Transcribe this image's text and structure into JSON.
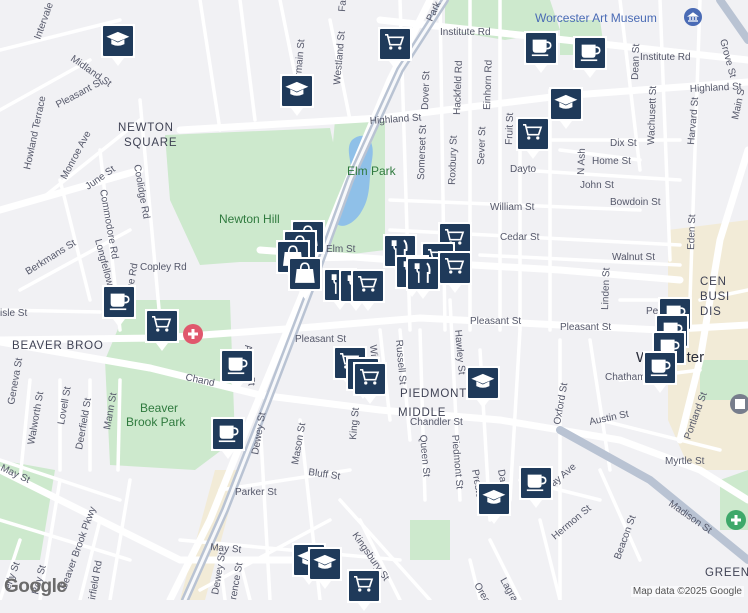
{
  "map": {
    "attribution": "Map data ©2025 Google",
    "logo": "Google",
    "colors": {
      "background": "#f1f1f4",
      "park": "#cde9cd",
      "park_dark": "#b7dcb9",
      "water": "#8fc0e8",
      "road_major": "#ffffff",
      "highway": "#b9c3d3",
      "downtown": "#f3ead0",
      "marker": "#1f3a5a",
      "poi": "#4a6bb5"
    },
    "places": {
      "newton_square_1": "NEWTON",
      "newton_square_2": "SQUARE",
      "beaver_brook": "BEAVER BROO",
      "piedmont": "PIEDMONT",
      "middle": "MIDDLE",
      "worcester": "Worcester",
      "central_1": "CEN",
      "central_2": "BUSI",
      "central_3": "DIS",
      "green": "GREEN"
    },
    "parks": {
      "elm_park": "Elm Park",
      "newton_hill": "Newton Hill",
      "beaver_brook_park_1": "Beaver",
      "beaver_brook_park_2": "Brook Park"
    },
    "poi": {
      "art_museum": "Worcester Art Museum"
    },
    "streets": {
      "institute_rd_1": "Institute Rd",
      "institute_rd_2": "Institute Rd",
      "highland_st_1": "Highland St",
      "highland_st_2": "Highland St",
      "pleasant_st_1": "Pleasant St",
      "pleasant_st_2": "Pleasant St",
      "pleasant_st_3": "Pleasant St",
      "pleasant_st_4": "Pleasant St",
      "chandler_st_1": "Chandler St",
      "chandler_st_2": "Chandler St",
      "chand": "Chand",
      "william_st": "William St",
      "cedar_st": "Cedar St",
      "walnut_st": "Walnut St",
      "elm_st": "Elm St",
      "copley_rd": "Copley Rd",
      "june_st": "June St",
      "coolidge_rd_1": "Coolidge Rd",
      "coolidge_rd_2": "Coolidge Rd",
      "commodore_rd": "Commodore Rd",
      "longfellow_rd": "Longfellow Rd",
      "berkmans_st": "Berkmans St",
      "monroe_ave": "Monroe Ave",
      "howland_terrace": "Howland Terrace",
      "midland_st": "Midland St",
      "intervale": "Intervale",
      "westland_st": "Westland St",
      "germain_st": "Germain St",
      "fa": "Fa",
      "park": "Park",
      "dover_st": "Dover St",
      "hackfeld_rd": "Hackfeld Rd",
      "einhorn_rd": "Einhorn Rd",
      "somerset_st": "Somerset St",
      "roxbury_st": "Roxbury St",
      "sever_st": "Sever St",
      "fruit_st": "Fruit St",
      "n_ash": "N Ash",
      "dix_st": "Dix St",
      "home_st": "Home St",
      "wachusett_st": "Wachusett St",
      "john_st": "John St",
      "bowdoin_st": "Bowdoin St",
      "dayto": "Dayto",
      "dean_st": "Dean St",
      "harvard_st": "Harvard St",
      "grove_st": "Grove St",
      "main_st": "Main S",
      "eden_st": "Eden St",
      "linden_st": "Linden St",
      "pearl_st": "Pearl St",
      "chatham": "Chatham",
      "austin_st": "Austin St",
      "myrtle_st": "Myrtle St",
      "portland_st": "Portland St",
      "madison_st": "Madison St",
      "oxford_st": "Oxford St",
      "beacon_st": "Beacon St",
      "hermon_st": "Hermon St",
      "murray_ave": "Murray Ave",
      "dale_st": "Dale St",
      "preston": "Preston",
      "piedmont_st": "Piedmont St",
      "hawley_st": "Hawley St",
      "queen_st": "Queen St",
      "russell_st": "Russell St",
      "winslow": "Winslow",
      "king_st": "King St",
      "kingsbury_st": "Kingsbury St",
      "bluff_st": "Bluff St",
      "parker_st": "Parker St",
      "may_st_1": "May St",
      "may_st_2": "May St",
      "dewey_st_1": "Dewey St",
      "dewey_st_2": "Dewey St",
      "mason_st": "Mason St",
      "abbott_st": "Abbott St",
      "park_ave": "Park Ave",
      "lagrange": "Lagrange",
      "orea": "Orea",
      "lawrence_st": "rence St",
      "roy_st": "Roy St",
      "beaver_brook_pkwy": "Beaver Brook Pkwy",
      "fairfield_rd": "irfield Rd",
      "waverly": "erly St",
      "walworth_st": "Walworth St",
      "lovell_st": "Lovell St",
      "deerfield_st": "Deerfield St",
      "mann_st": "Mann St",
      "genev": "Geneva St",
      "carlisle": "isle St"
    },
    "markers": [
      {
        "type": "school",
        "icon": "graduation-cap-icon"
      },
      {
        "type": "shopping",
        "icon": "shopping-cart-icon"
      },
      {
        "type": "school",
        "icon": "graduation-cap-icon"
      },
      {
        "type": "cafe",
        "icon": "coffee-cup-icon"
      },
      {
        "type": "cafe",
        "icon": "coffee-cup-icon"
      },
      {
        "type": "school",
        "icon": "graduation-cap-icon"
      },
      {
        "type": "shopping",
        "icon": "shopping-cart-icon"
      },
      {
        "type": "store",
        "icon": "shopping-bag-icon"
      },
      {
        "type": "store",
        "icon": "shopping-bag-icon"
      },
      {
        "type": "store",
        "icon": "shopping-bag-icon"
      },
      {
        "type": "store",
        "icon": "shopping-bag-icon"
      },
      {
        "type": "restaurant",
        "icon": "fork-knife-icon"
      },
      {
        "type": "restaurant",
        "icon": "fork-knife-icon"
      },
      {
        "type": "shopping",
        "icon": "shopping-cart-icon"
      },
      {
        "type": "shopping",
        "icon": "shopping-cart-icon"
      },
      {
        "type": "restaurant",
        "icon": "fork-knife-icon"
      },
      {
        "type": "shopping",
        "icon": "shopping-cart-icon"
      },
      {
        "type": "restaurant",
        "icon": "fork-knife-icon"
      },
      {
        "type": "restaurant",
        "icon": "fork-knife-icon"
      },
      {
        "type": "shopping",
        "icon": "shopping-cart-icon"
      },
      {
        "type": "cafe",
        "icon": "coffee-cup-icon"
      },
      {
        "type": "shopping",
        "icon": "shopping-cart-icon"
      },
      {
        "type": "cafe",
        "icon": "coffee-cup-icon"
      },
      {
        "type": "shopping",
        "icon": "shopping-cart-icon"
      },
      {
        "type": "shopping",
        "icon": "shopping-cart-icon"
      },
      {
        "type": "shopping",
        "icon": "shopping-cart-icon"
      },
      {
        "type": "school",
        "icon": "graduation-cap-icon"
      },
      {
        "type": "cafe",
        "icon": "coffee-cup-icon"
      },
      {
        "type": "cafe",
        "icon": "coffee-cup-icon"
      },
      {
        "type": "cafe",
        "icon": "coffee-cup-icon"
      },
      {
        "type": "cafe",
        "icon": "coffee-cup-icon"
      },
      {
        "type": "cafe",
        "icon": "coffee-cup-icon"
      },
      {
        "type": "school",
        "icon": "graduation-cap-icon"
      },
      {
        "type": "cafe",
        "icon": "coffee-cup-icon"
      },
      {
        "type": "school",
        "icon": "graduation-cap-icon"
      },
      {
        "type": "school",
        "icon": "graduation-cap-icon"
      },
      {
        "type": "shopping",
        "icon": "shopping-cart-icon"
      }
    ]
  }
}
